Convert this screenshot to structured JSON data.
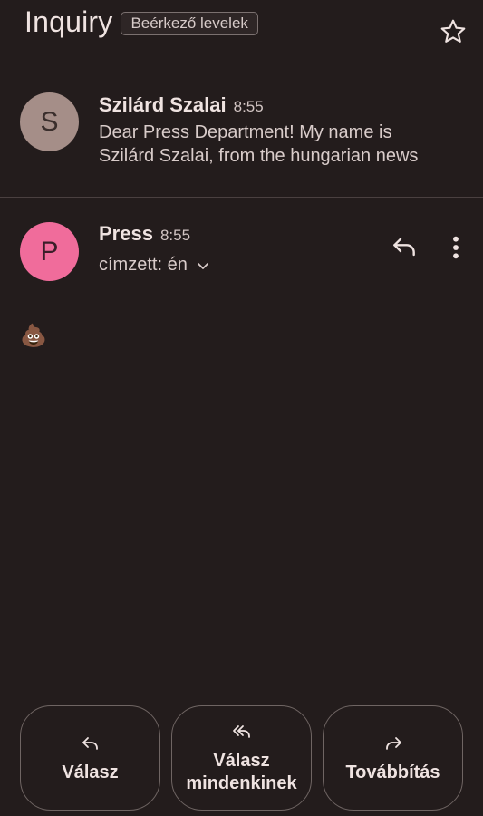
{
  "thread": {
    "subject": "Inquiry",
    "label": "Beérkező levelek",
    "star_icon": "star-outline-icon"
  },
  "messages": [
    {
      "avatar_letter": "S",
      "avatar_color": "#a58e88",
      "sender": "Szilárd Szalai",
      "time": "8:55",
      "snippet_line1": "Dear Press Department! My name is",
      "snippet_line2": "Szilárd Szalai, from the hungarian news"
    },
    {
      "avatar_letter": "P",
      "avatar_color": "#f06c9b",
      "sender": "Press",
      "time": "8:55",
      "recipient": "címzett: én",
      "body": "💩"
    }
  ],
  "actions": {
    "reply": "Válasz",
    "reply_all_line1": "Válasz",
    "reply_all_line2": "mindenkinek",
    "forward": "Továbbítás"
  },
  "colors": {
    "background": "#231c1c",
    "text": "#efe3e1",
    "accent_pink": "#f06c9b"
  }
}
